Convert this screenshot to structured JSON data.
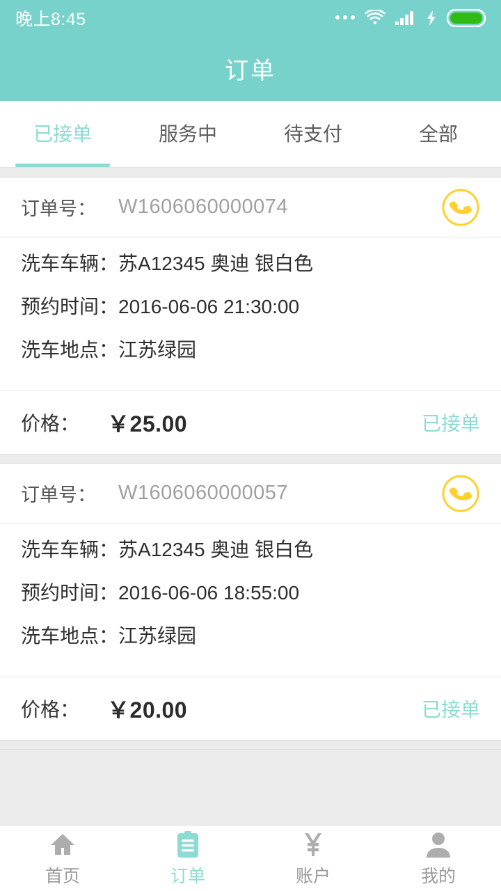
{
  "statusbar": {
    "time": "晚上8:45",
    "icons": [
      "more-dots-icon",
      "wifi-icon",
      "signal-bars-icon",
      "charging-bolt-icon",
      "battery-icon"
    ],
    "battery_color": "#2fbb12"
  },
  "header": {
    "title": "订单",
    "bg_color": "#76d2cb"
  },
  "tabs": {
    "active_index": 0,
    "accent_color": "#8ddbd3",
    "items": [
      {
        "label": "已接单"
      },
      {
        "label": "服务中"
      },
      {
        "label": "待支付"
      },
      {
        "label": "全部"
      }
    ]
  },
  "labels": {
    "order_no": "订单号：",
    "vehicle": "洗车车辆：",
    "appointment": "预约时间：",
    "location": "洗车地点：",
    "price": "价格："
  },
  "orders": [
    {
      "order_no": "W1606060000074",
      "vehicle": "苏A12345 奥迪 银白色",
      "appointment": "2016-06-06 21:30:00",
      "location": "江苏绿园",
      "price": "￥25.00",
      "status": "已接单",
      "call_icon": "phone-call-icon"
    },
    {
      "order_no": "W1606060000057",
      "vehicle": "苏A12345 奥迪 银白色",
      "appointment": "2016-06-06 18:55:00",
      "location": "江苏绿园",
      "price": "￥20.00",
      "status": "已接单",
      "call_icon": "phone-call-icon"
    }
  ],
  "bottomnav": {
    "active_index": 1,
    "items": [
      {
        "label": "首页",
        "icon": "home-icon"
      },
      {
        "label": "订单",
        "icon": "clipboard-icon"
      },
      {
        "label": "账户",
        "icon": "yuan-icon"
      },
      {
        "label": "我的",
        "icon": "person-icon"
      }
    ]
  },
  "colors": {
    "accent": "#8ddbd3",
    "header": "#76d2cb",
    "phone_yellow": "#ffd02e",
    "page_bg": "#ececec"
  }
}
